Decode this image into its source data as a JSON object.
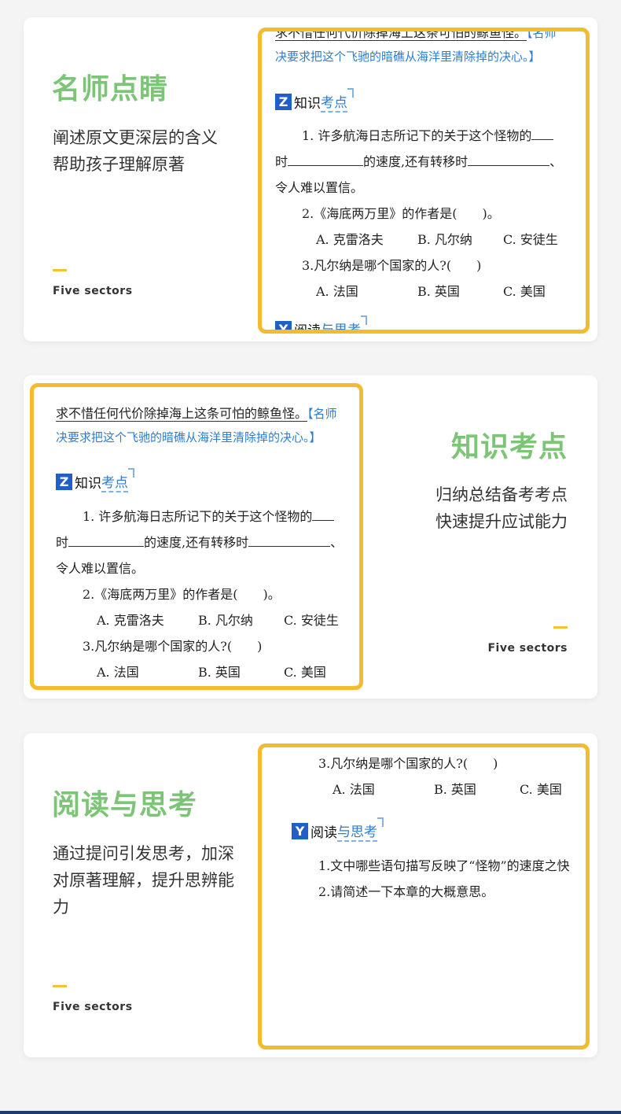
{
  "cards": [
    {
      "title": "名师点睛",
      "desc": [
        "阐述原文更深层的含义",
        "帮助孩子理解原著"
      ],
      "footer": "Five sectors"
    },
    {
      "title": "知识考点",
      "desc": [
        "归纳总结备考考点",
        "快速提升应试能力"
      ],
      "footer": "Five sectors"
    },
    {
      "title": "阅读与思考",
      "desc": [
        "通过提问引发思考，加深",
        "对原著理解，提升思辨能",
        "力"
      ],
      "footer": "Five sectors"
    }
  ],
  "doc": {
    "line0": "求不惜任何代价除掉海上这条可怕的鲸鱼怪。",
    "note_start": "【名师",
    "note_line2": "决要求把这个飞驰的暗礁从海洋里清除掉的决心。】",
    "z_badge": "Z",
    "z_a": "知识",
    "z_b": "考点",
    "q1_a": "1. 许多航海日志所记下的关于这个怪物的",
    "q1_b": "时",
    "q1_c": "的速度,还有转移时",
    "q1_d": "、",
    "q1_e": "令人难以置信。",
    "q2": "2.《海底两万里》的作者是(　　)。",
    "q2_a": "A. 克雷洛夫",
    "q2_b": "B. 凡尔纳",
    "q2_c": "C. 安徒生",
    "q3": "3.凡尔纳是哪个国家的人?(　　)",
    "q3_a": "A. 法国",
    "q3_b": "B. 英国",
    "q3_c": "C. 美国",
    "y_badge": "Y",
    "y_a": "阅读",
    "y_b": "与思考",
    "r1": "1.文中哪些语句描写反映了“怪物”的速度之快",
    "r2": "2.请简述一下本章的大概意思。"
  },
  "colors": {
    "title_green": "#7cc576",
    "frame_yellow": "#f4bc2c",
    "badge_blue": "#1f5fc7",
    "note_blue": "#2d7dd2"
  },
  "icons": [
    "toggle-switch-icon"
  ]
}
